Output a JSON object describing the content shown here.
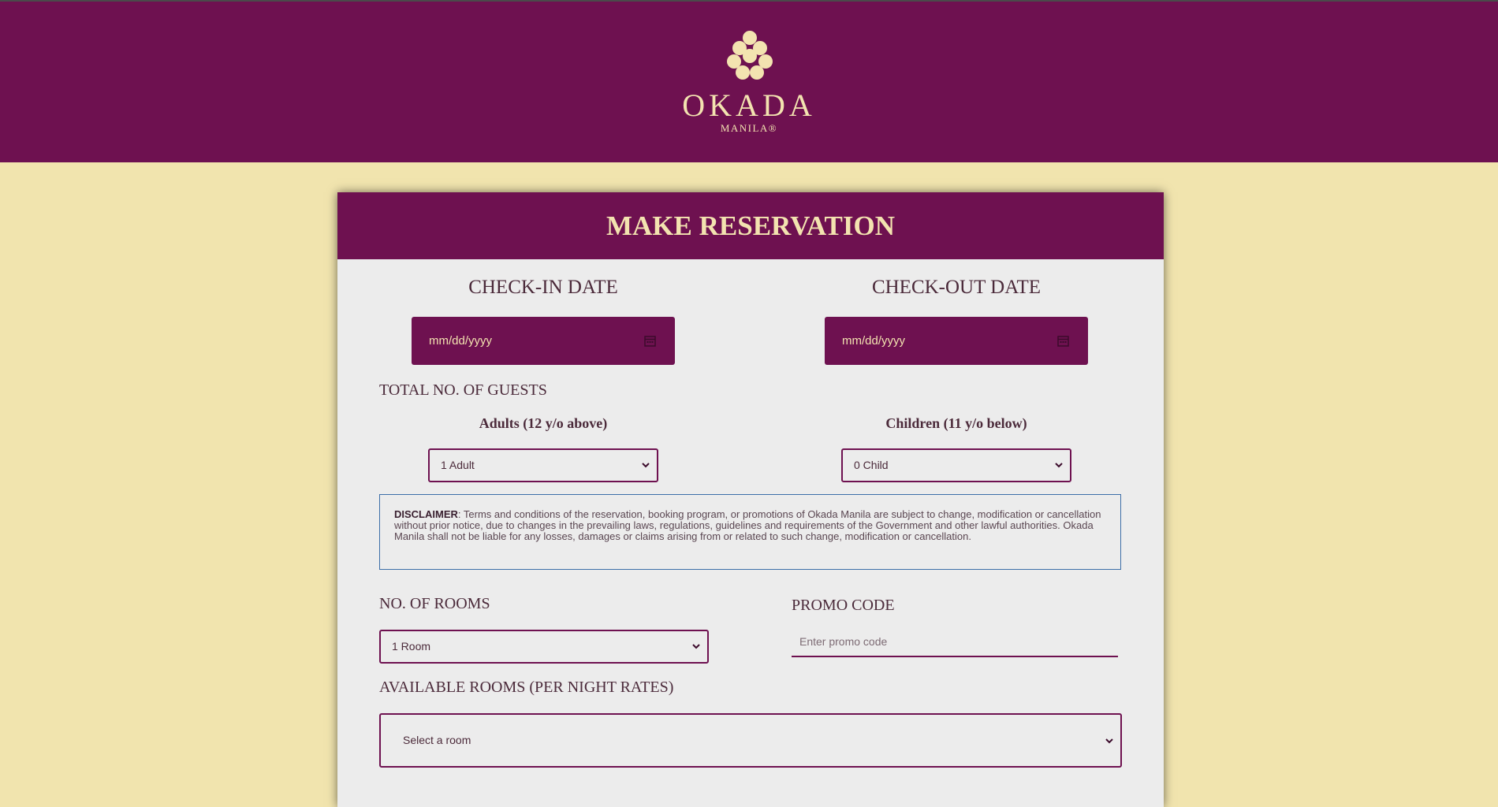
{
  "header": {
    "brand": "OKADA",
    "brand_sub": "MANILA®"
  },
  "form": {
    "title": "MAKE RESERVATION",
    "checkin": {
      "label": "CHECK-IN DATE",
      "placeholder": "mm/dd/yyyy"
    },
    "checkout": {
      "label": "CHECK-OUT DATE",
      "placeholder": "mm/dd/yyyy"
    },
    "guests": {
      "label": "TOTAL NO. OF GUESTS",
      "adults_label": "Adults (12 y/o above)",
      "adults_value": "1 Adult",
      "children_label": "Children (11 y/o below)",
      "children_value": "0 Child"
    },
    "disclaimer": {
      "heading": "DISCLAIMER",
      "text": ": Terms and conditions of the reservation, booking program, or promotions of Okada Manila are subject to change, modification or cancellation without prior notice, due to changes in the prevailing laws, regulations, guidelines and requirements of the Government and other lawful authorities. Okada Manila shall not be liable for any losses, damages or claims arising from or related to such change, modification or cancellation."
    },
    "rooms": {
      "label": "NO. OF ROOMS",
      "value": "1 Room"
    },
    "promo": {
      "label": "PROMO CODE",
      "placeholder": "Enter promo code"
    },
    "available": {
      "label": "AVAILABLE ROOMS (PER NIGHT RATES)",
      "value": "Select a room"
    }
  },
  "icons": {
    "logo": "okada-flower-icon",
    "calendar": "calendar-icon",
    "chevron": "chevron-down-icon"
  },
  "colors": {
    "brand": "#6e1150",
    "background": "#f1e4ae",
    "gold": "#f3e3b0",
    "card": "#ececec"
  }
}
